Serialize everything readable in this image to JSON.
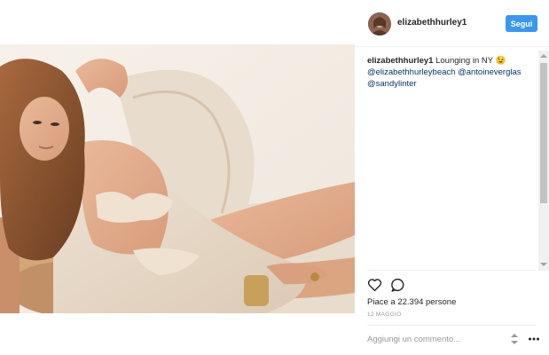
{
  "post": {
    "username": "elizabethhurley1",
    "follow_label": "Segui",
    "image_description": "photo-woman-lounging",
    "caption": {
      "username": "elizabethhurley1",
      "text": "Lounging in NY",
      "emoji": "😉",
      "mentions": [
        "@elizabethhurleybeach",
        "@antoineverglas",
        "@sandylinter"
      ]
    },
    "likes_text": "Piace a 22.394 persone",
    "date": "12 MAGGIO",
    "comment_placeholder": "Aggiungi un commento..."
  },
  "icons": {
    "like": "heart-outline-icon",
    "comment": "speech-bubble-icon",
    "sort": "sort-arrows-icon",
    "more": "ellipsis-icon"
  },
  "colors": {
    "follow_button": "#3897f0",
    "mention": "#003569",
    "text": "#262626",
    "muted": "#999999"
  }
}
